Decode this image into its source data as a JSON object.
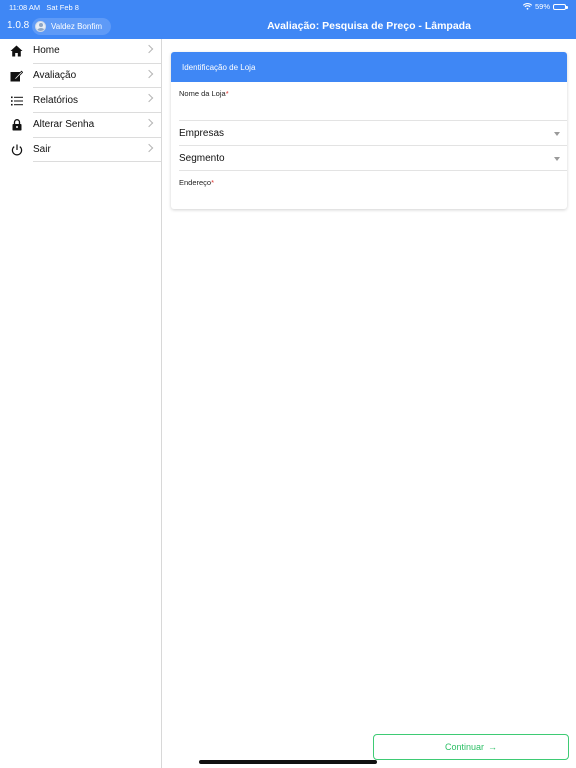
{
  "status_bar": {
    "time": "11:08 AM",
    "date": "Sat Feb 8",
    "battery": "59%",
    "battery_level": 0.59
  },
  "app": {
    "version": "1.0.8",
    "user_name": "Valdez Bonfim",
    "page_title": "Avaliação: Pesquisa de Preço - Lâmpada",
    "accent_color": "#3f87f5",
    "continue_color": "#2bbf64"
  },
  "sidebar": {
    "items": [
      {
        "label": "Home",
        "icon": "home-icon"
      },
      {
        "label": "Avaliação",
        "icon": "edit-icon"
      },
      {
        "label": "Relatórios",
        "icon": "list-icon"
      },
      {
        "label": "Alterar Senha",
        "icon": "lock-icon"
      },
      {
        "label": "Sair",
        "icon": "power-icon"
      }
    ]
  },
  "form": {
    "section_title": "Identificação de Loja",
    "store_name_label": "Nome da Loja",
    "store_name_value": "",
    "companies_select": "Empresas",
    "segment_select": "Segmento",
    "address_label": "Endereço",
    "address_value": "",
    "required_mark": "*"
  },
  "actions": {
    "continue_label": "Continuar",
    "continue_arrow": "→"
  }
}
